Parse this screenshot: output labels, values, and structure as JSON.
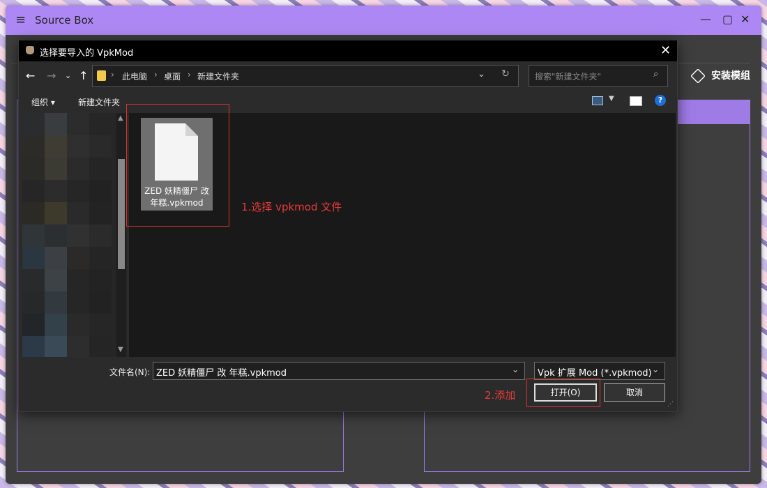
{
  "app": {
    "title": "Source Box",
    "install_label": "安装模组"
  },
  "dialog": {
    "title": "选择要导入的 VpkMod",
    "breadcrumbs": [
      "此电脑",
      "桌面",
      "新建文件夹"
    ],
    "search_placeholder": "搜索\"新建文件夹\"",
    "toolbar": {
      "organize": "组织 ▾",
      "new_folder": "新建文件夹"
    },
    "file": {
      "name": "ZED 妖精僵尸 改 年糕.vpkmod"
    },
    "filename_label": "文件名(N):",
    "filename_value": "ZED 妖精僵尸 改 年糕.vpkmod",
    "filetype_value": "Vpk 扩展 Mod (*.vpkmod)",
    "open_label": "打开(O)",
    "cancel_label": "取消"
  },
  "annotations": {
    "step1": "1.选择 vpkmod 文件",
    "step2": "2.添加"
  },
  "colors": {
    "accent": "#ad88f4",
    "annotation": "#e03030"
  }
}
